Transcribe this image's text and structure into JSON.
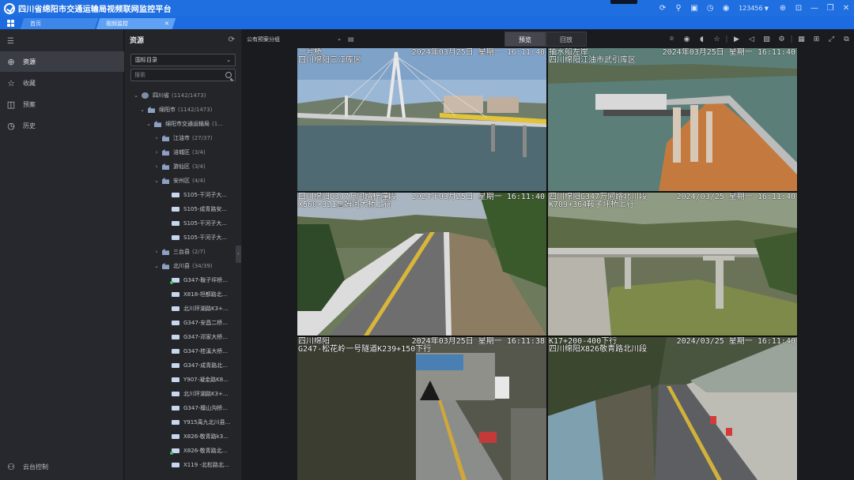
{
  "app": {
    "title": "四川省绵阳市交通运输局视频联网监控平台"
  },
  "titlebar": {
    "user": "123456"
  },
  "tabs": [
    {
      "label": "首页"
    },
    {
      "label": "视频监控"
    }
  ],
  "leftnav": {
    "items": [
      {
        "label": "资源"
      },
      {
        "label": "收藏"
      },
      {
        "label": "预案"
      },
      {
        "label": "历史"
      }
    ],
    "bottom": "云台控制"
  },
  "resource": {
    "title": "资源",
    "dir_select": "国标目录",
    "search_placeholder": "搜索",
    "tree": [
      {
        "name": "四川省",
        "count": "(1142/1473)"
      },
      {
        "name": "绵阳市",
        "count": "(1142/1473)"
      },
      {
        "name": "绵阳市交通运输局",
        "count": "(1..."
      },
      {
        "name": "江油市",
        "count": "(27/37)"
      },
      {
        "name": "涪城区",
        "count": "(3/4)"
      },
      {
        "name": "游仙区",
        "count": "(3/4)"
      },
      {
        "name": "安州区",
        "count": "(4/4)"
      },
      {
        "name": "S105-干河子大..."
      },
      {
        "name": "S105-成青路安..."
      },
      {
        "name": "S105-干河子大..."
      },
      {
        "name": "S105-干河子大..."
      },
      {
        "name": "三台县",
        "count": "(2/7)"
      },
      {
        "name": "北川县",
        "count": "(34/39)"
      },
      {
        "name": "G347-鞍子坪桥..."
      },
      {
        "name": "X818-坦都路北..."
      },
      {
        "name": "北川环湖路K3+..."
      },
      {
        "name": "G347-安昌二桥..."
      },
      {
        "name": "G347-邓家大桥..."
      },
      {
        "name": "G347-桂溪大桥..."
      },
      {
        "name": "G347-成青路北..."
      },
      {
        "name": "Y907-凝金路K8..."
      },
      {
        "name": "北川环湖路K3+..."
      },
      {
        "name": "G347-檀山沟桥..."
      },
      {
        "name": "Y915禹九北川县..."
      },
      {
        "name": "X826-敬青路k3..."
      },
      {
        "name": "X826-敬青路北..."
      },
      {
        "name": "X119 -北松路北..."
      }
    ]
  },
  "toolbar": {
    "group": "公有预案分组",
    "mode_preview": "预览",
    "mode_playback": "回放"
  },
  "videos": [
    {
      "ts": "2024年03月25日  星期一  16:11:40",
      "l1": "一号桥",
      "l2": "四川绵阳三江库区"
    },
    {
      "ts": "2024年03月25日  星期一  16:11:40",
      "l1": "抽水船左岸",
      "l2": "四川绵阳江油市武引库区"
    },
    {
      "ts": "2024年03月25日  星期一  16:11:40",
      "l1": "四川绵阳G347万阿路梓潼段",
      "l2": "X560+321詹姆河大桥上行"
    },
    {
      "ts": "2024/03/25  星期一  16:11:40",
      "l1": "四川绵阳G347万阿路北川段",
      "l2": "K709+364鞍子坪桥上行"
    },
    {
      "ts": "2024年03月25日  星期一  16:11:38",
      "l1": "四川绵阳",
      "l2": "G247-松花岭一号隧道K239+150下行"
    },
    {
      "ts": "2024/03/25  星期一  16:11:40",
      "l1": "K17+200-400下行",
      "l2": "四川绵阳X826敬青路北川段"
    }
  ]
}
